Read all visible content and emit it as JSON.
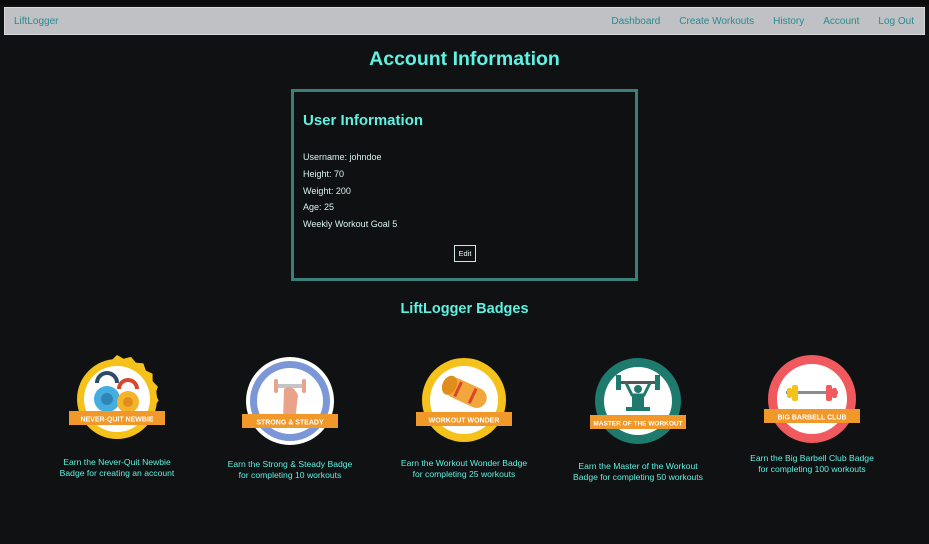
{
  "nav": {
    "brand": "LiftLogger",
    "links": [
      "Dashboard",
      "Create Workouts",
      "History",
      "Account",
      "Log Out"
    ]
  },
  "page": {
    "title": "Account Information"
  },
  "user_info": {
    "heading": "User Information",
    "lines": [
      "Username: johndoe",
      "Height: 70",
      "Weight: 200",
      "Age: 25",
      "Weekly Workout Goal 5"
    ],
    "edit_label": "Edit"
  },
  "badges": {
    "heading": "LiftLogger Badges",
    "items": [
      {
        "banner": "NEVER-QUIT NEWBIE",
        "caption": [
          "Earn the Never-Quit Newbie",
          "Badge for creating an account"
        ],
        "ring_color": "#f5c21b",
        "ribbon_color": "#f0982a",
        "icon": "kettlebells-icon"
      },
      {
        "banner": "STRONG & STEADY",
        "caption": [
          "Earn the Strong & Steady Badge",
          "for completing 10 workouts"
        ],
        "ring_color": "#7b97d8",
        "ribbon_color": "#f0982a",
        "icon": "flexed-arm-icon"
      },
      {
        "banner": "WORKOUT WONDER",
        "caption": [
          "Earn the Workout Wonder Badge",
          "for completing 25 workouts"
        ],
        "ring_color": "#f5c21b",
        "ribbon_color": "#f0982a",
        "icon": "yoga-mat-icon"
      },
      {
        "banner": "MASTER OF THE WORKOUT",
        "caption": [
          "Earn the Master of the Workout",
          "Badge for completing 50 workouts"
        ],
        "ring_color": "#1f7a6e",
        "ribbon_color": "#f0982a",
        "icon": "weightlifter-icon"
      },
      {
        "banner": "BIG BARBELL CLUB",
        "caption": [
          "Earn the Big Barbell Club Badge",
          "for completing 100 workouts"
        ],
        "ring_color": "#f05a5e",
        "ribbon_color": "#f0982a",
        "icon": "barbell-icon"
      }
    ]
  },
  "colors": {
    "accent": "#5ef2e2",
    "nav_link": "#2a8b90",
    "navbar_bg": "#bfc1c4",
    "card_border": "#3a7f7a",
    "page_bg": "#101113"
  }
}
